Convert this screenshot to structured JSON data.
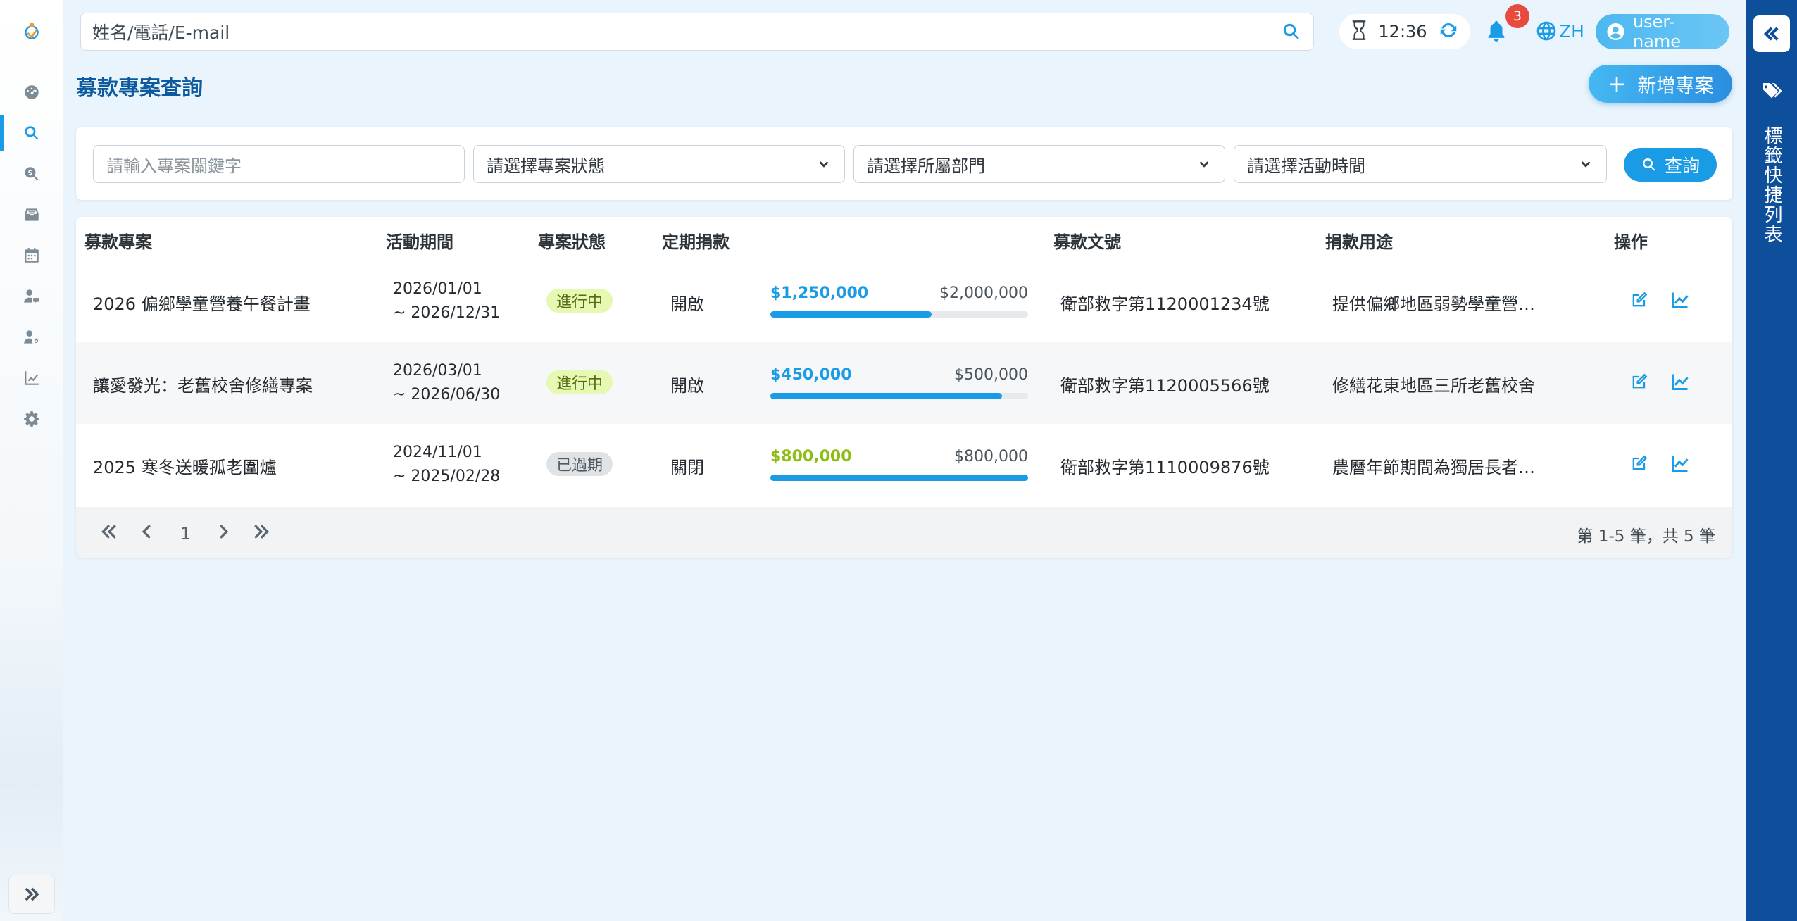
{
  "topbar": {
    "search_placeholder": "姓名/電話/E-mail",
    "time": "12:36",
    "notification_count": "3",
    "language": "ZH",
    "user_name": "user-name"
  },
  "sidebar": {
    "active_item": "search",
    "items": [
      "dashboard-icon",
      "search-icon",
      "search-dollar-icon",
      "inbox-icon",
      "calendar-icon",
      "user-chat-icon",
      "user-gear-icon",
      "chart-line-icon",
      "gear-icon"
    ]
  },
  "right_panel": {
    "label": "標籤快捷列表"
  },
  "page": {
    "title": "募款專案查詢",
    "add_button": "新增專案"
  },
  "filters": {
    "keyword_placeholder": "請輸入專案關鍵字",
    "status_select": "請選擇專案狀態",
    "department_select": "請選擇所屬部門",
    "period_select": "請選擇活動時間",
    "query_button": "查詢"
  },
  "table": {
    "headers": {
      "name": "募款專案",
      "period": "活動期間",
      "status": "專案狀態",
      "recurring": "定期捐款",
      "doc_no": "募款文號",
      "purpose": "捐款用途",
      "actions": "操作"
    },
    "rows": [
      {
        "name": "2026 偏鄉學童營養午餐計畫",
        "period_start": "2026/01/01",
        "period_end": "~ 2026/12/31",
        "status": "進行中",
        "recurring": "開啟",
        "raised": "$1,250,000",
        "goal": "$2,000,000",
        "progress": 0.625,
        "doc_no": "衛部救字第1120001234號",
        "purpose": "提供偏鄉地區弱勢學童營…"
      },
      {
        "name": "讓愛發光：老舊校舍修繕專案",
        "period_start": "2026/03/01",
        "period_end": "~ 2026/06/30",
        "status": "進行中",
        "recurring": "開啟",
        "raised": "$450,000",
        "goal": "$500,000",
        "progress": 0.9,
        "doc_no": "衛部救字第1120005566號",
        "purpose": "修繕花東地區三所老舊校舍"
      },
      {
        "name": "2025 寒冬送暖孤老圍爐",
        "period_start": "2024/11/01",
        "period_end": "~ 2025/02/28",
        "status": "已過期",
        "recurring": "關閉",
        "raised": "$800,000",
        "goal": "$800,000",
        "progress": 1.0,
        "doc_no": "衛部救字第1110009876號",
        "purpose": "農曆年節期間為獨居長者…"
      }
    ]
  },
  "pagination": {
    "current_page": "1",
    "summary": "第 1-5 筆，共 5 筆"
  },
  "colors": {
    "accent": "#1a9be6",
    "brand_dark": "#0d4f9a",
    "status_active_bg": "#e6f8b2",
    "status_expired_bg": "#dfe3e6",
    "raised_complete": "#8cbd12"
  }
}
